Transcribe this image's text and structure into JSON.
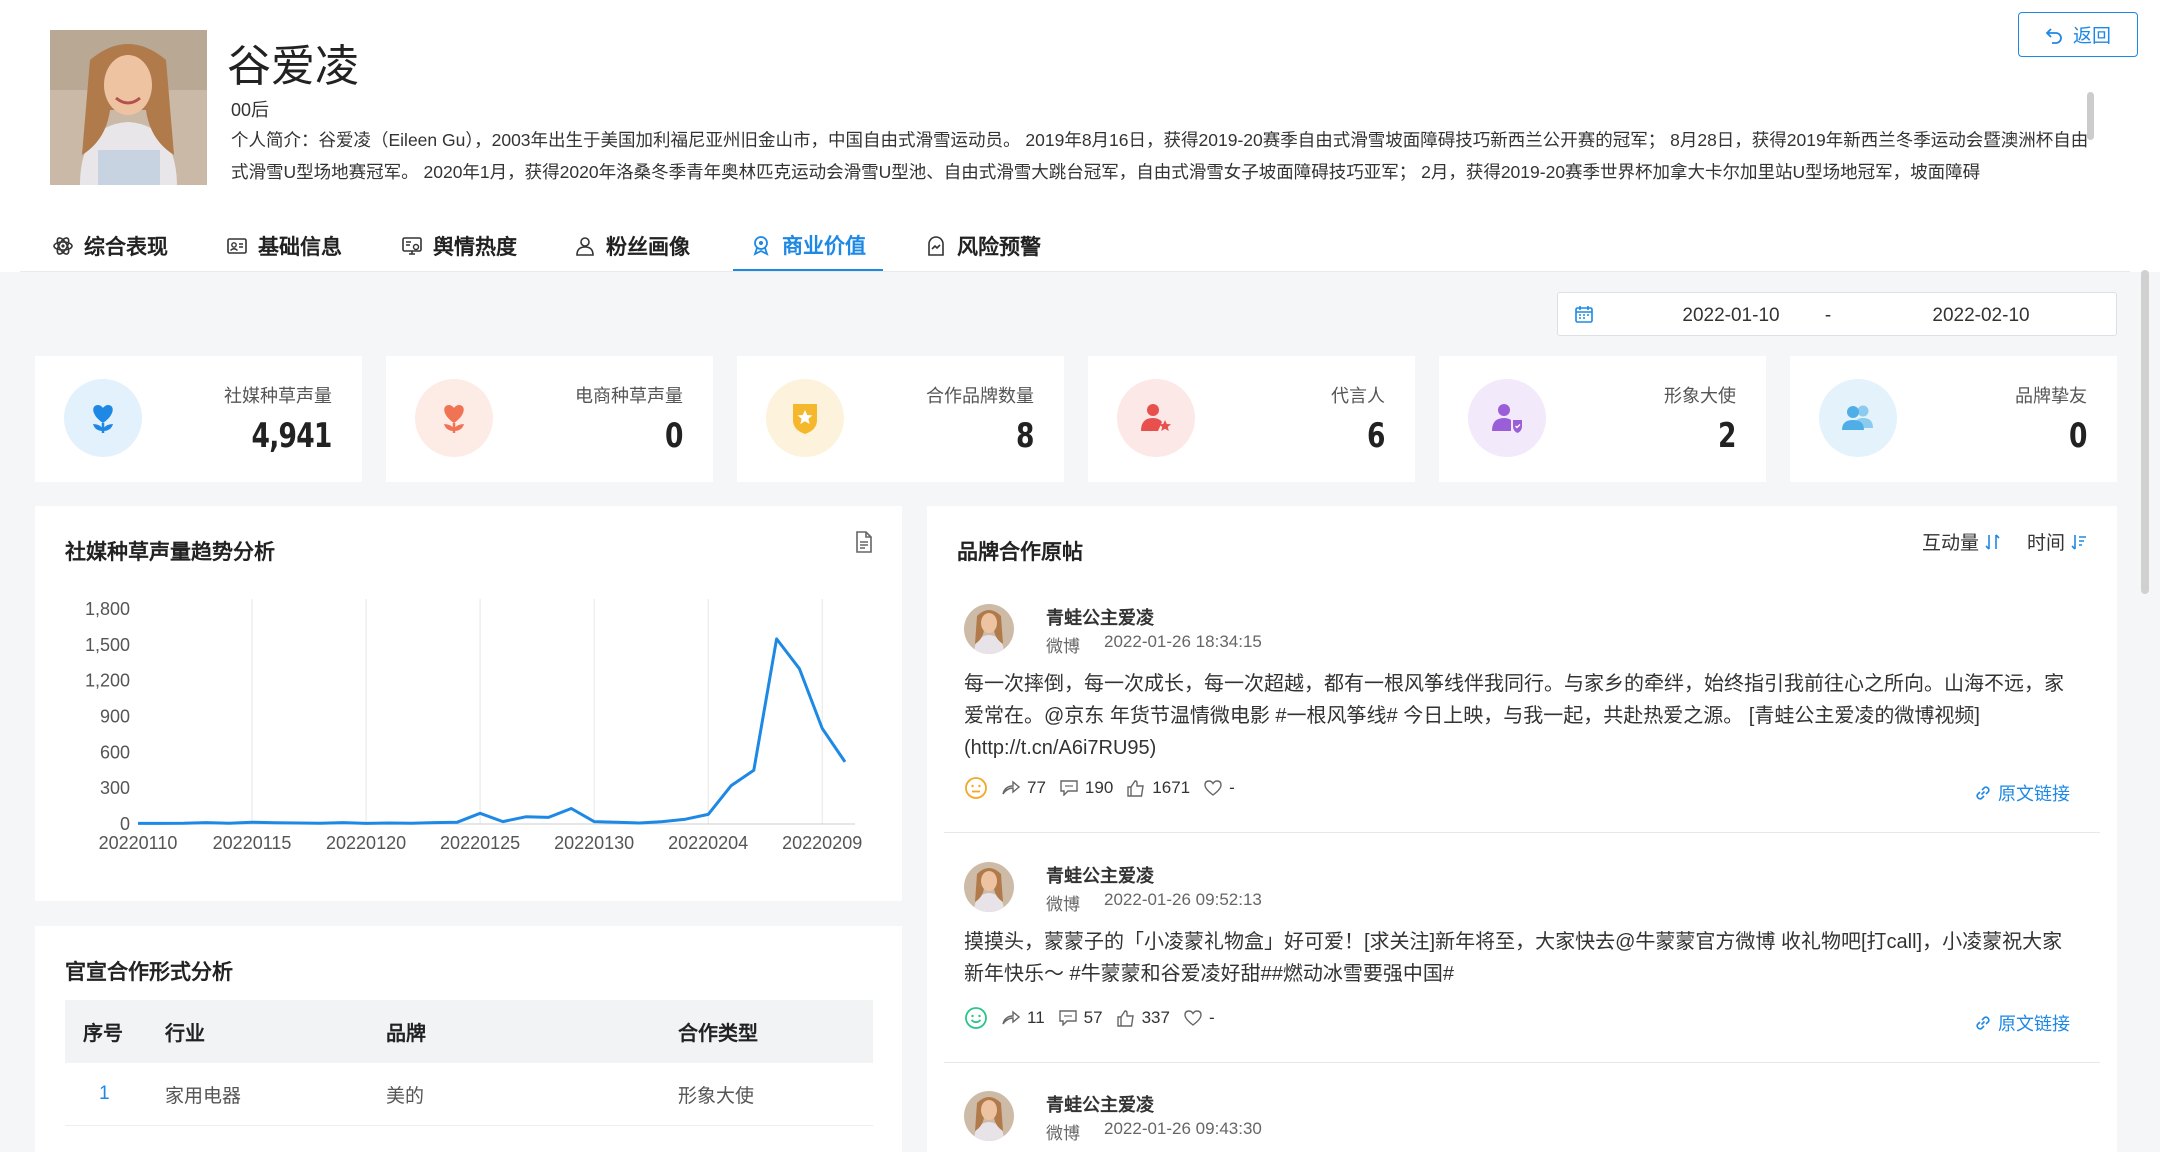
{
  "profile": {
    "name": "谷爱凌",
    "generation": "00后",
    "bio": "个人简介：谷爱凌（Eileen Gu），2003年出生于美国加利福尼亚州旧金山市，中国自由式滑雪运动员。 2019年8月16日，获得2019-20赛季自由式滑雪坡面障碍技巧新西兰公开赛的冠军； 8月28日，获得2019年新西兰冬季运动会暨澳洲杯自由式滑雪U型场地赛冠军。 2020年1月，获得2020年洛桑冬季青年奥林匹克运动会滑雪U型池、自由式滑雪大跳台冠军，自由式滑雪女子坡面障碍技巧亚军； 2月，获得2019-20赛季世界杯加拿大卡尔加里站U型场地冠军，坡面障碍"
  },
  "back_label": "返回",
  "tabs": [
    {
      "label": "综合表现",
      "icon": "atom-icon"
    },
    {
      "label": "基础信息",
      "icon": "id-card-icon"
    },
    {
      "label": "舆情热度",
      "icon": "monitor-icon"
    },
    {
      "label": "粉丝画像",
      "icon": "user-icon"
    },
    {
      "label": "商业价值",
      "icon": "badge-icon",
      "active": true
    },
    {
      "label": "风险预警",
      "icon": "warning-icon"
    }
  ],
  "date_range": {
    "start": "2022-01-10",
    "separator": "-",
    "end": "2022-02-10"
  },
  "metrics": [
    {
      "label": "社媒种草声量",
      "value": "4,941",
      "icon": "flower-heart-icon",
      "bg": "#e3f1fc",
      "color": "#1e88e5"
    },
    {
      "label": "电商种草声量",
      "value": "0",
      "icon": "flower-heart-icon",
      "bg": "#fdece6",
      "color": "#f07453"
    },
    {
      "label": "合作品牌数量",
      "value": "8",
      "icon": "shield-star-icon",
      "bg": "#fdf3dc",
      "color": "#f5b72c"
    },
    {
      "label": "代言人",
      "value": "6",
      "icon": "user-star-icon",
      "bg": "#fde8e8",
      "color": "#e8504d"
    },
    {
      "label": "形象大使",
      "value": "2",
      "icon": "user-shield-icon",
      "bg": "#f2e9fb",
      "color": "#9a5ed8"
    },
    {
      "label": "品牌挚友",
      "value": "0",
      "icon": "users-icon",
      "bg": "#e4f3fb",
      "color": "#4faee6"
    }
  ],
  "trend": {
    "title": "社媒种草声量趋势分析"
  },
  "chart_data": {
    "type": "line",
    "title": "社媒种草声量趋势分析",
    "xlabel": "",
    "ylabel": "",
    "ylim": [
      0,
      1800
    ],
    "yticks": [
      "0",
      "300",
      "600",
      "900",
      "1,200",
      "1,500",
      "1,800"
    ],
    "xticks": [
      "20220110",
      "20220115",
      "20220120",
      "20220125",
      "20220130",
      "20220204",
      "20220209"
    ],
    "grid": "vertical",
    "x": [
      "20220110",
      "20220111",
      "20220112",
      "20220113",
      "20220114",
      "20220115",
      "20220116",
      "20220117",
      "20220118",
      "20220119",
      "20220120",
      "20220121",
      "20220122",
      "20220123",
      "20220124",
      "20220125",
      "20220126",
      "20220127",
      "20220128",
      "20220129",
      "20220130",
      "20220131",
      "20220201",
      "20220202",
      "20220203",
      "20220204",
      "20220205",
      "20220206",
      "20220207",
      "20220208",
      "20220209",
      "20220210"
    ],
    "series": [
      {
        "values": [
          5,
          5,
          6,
          12,
          6,
          15,
          10,
          8,
          6,
          12,
          5,
          8,
          6,
          12,
          15,
          90,
          20,
          60,
          55,
          130,
          20,
          15,
          8,
          20,
          40,
          80,
          320,
          450,
          1550,
          1300,
          800,
          520
        ]
      }
    ]
  },
  "coop": {
    "title": "官宣合作形式分析",
    "headers": [
      "序号",
      "行业",
      "品牌",
      "合作类型"
    ],
    "rows": [
      {
        "no": "1",
        "industry": "家用电器",
        "brand": "美的",
        "type": "形象大使"
      }
    ]
  },
  "posts_panel": {
    "title": "品牌合作原帖",
    "sort_interaction": "互动量",
    "sort_time": "时间"
  },
  "posts": [
    {
      "user": "青蛙公主爱凌",
      "source": "微博",
      "time": "2022-01-26 18:34:15",
      "content": "每一次摔倒，每一次成长，每一次超越，都有一根风筝线伴我同行。与家乡的牵绊，始终指引我前往心之所向。山海不远，家爱常在。@京东 年货节温情微电影 #一根风筝线# 今日上映，与我一起，共赴热爱之源。 [青蛙公主爱凌的微博视频](http://t.cn/A6i7RU95)",
      "sentiment": "neutral",
      "sentiment_color": "#f5a623",
      "reposts": "77",
      "comments": "190",
      "likes": "1671",
      "favs": "-",
      "link": "原文链接"
    },
    {
      "user": "青蛙公主爱凌",
      "source": "微博",
      "time": "2022-01-26 09:52:13",
      "content": "摸摸头，蒙蒙子的「小凌蒙礼物盒」好可爱！[求关注]新年将至，大家快去@牛蒙蒙官方微博 收礼物吧[打call]，小凌蒙祝大家新年快乐～ #牛蒙蒙和谷爱凌好甜##燃动冰雪要强中国#",
      "sentiment": "positive",
      "sentiment_color": "#2bc48a",
      "reposts": "11",
      "comments": "57",
      "likes": "337",
      "favs": "-",
      "link": "原文链接"
    },
    {
      "user": "青蛙公主爱凌",
      "source": "微博",
      "time": "2022-01-26 09:43:30",
      "content": "",
      "sentiment": "",
      "reposts": "",
      "comments": "",
      "likes": "",
      "favs": "",
      "link": ""
    }
  ]
}
